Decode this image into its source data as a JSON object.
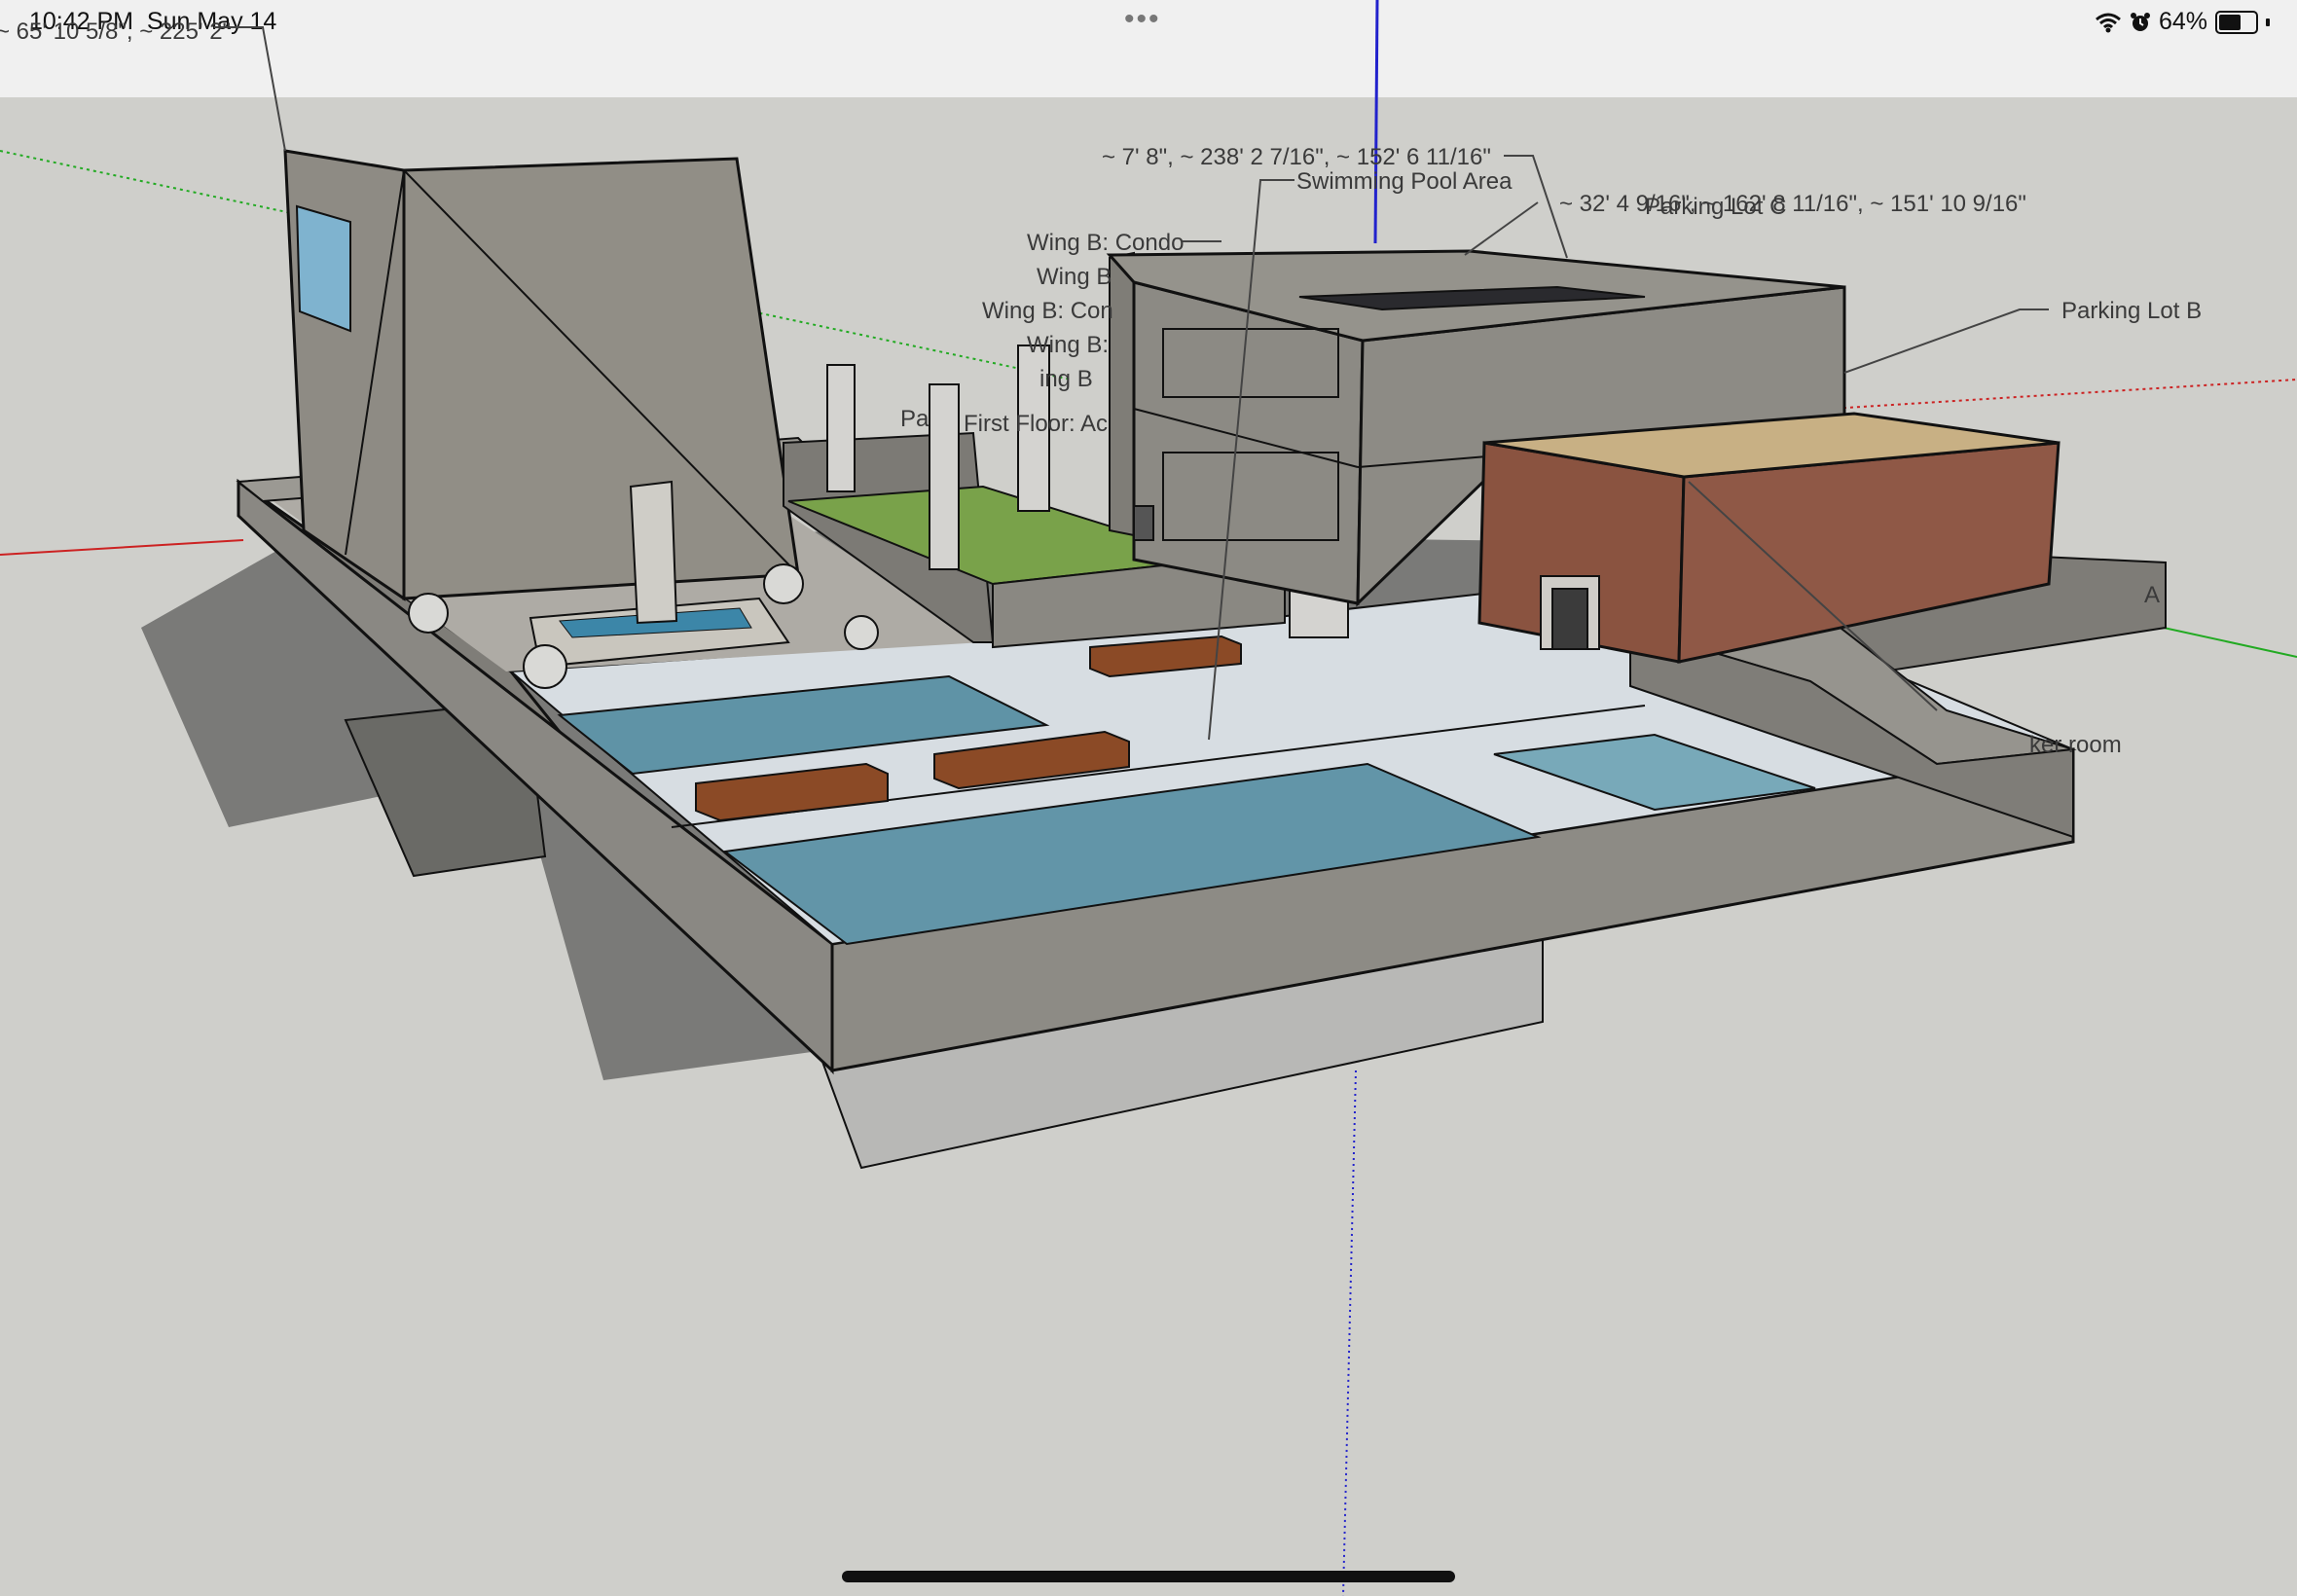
{
  "status_bar": {
    "time": "10:42 PM",
    "date": "Sun May 14",
    "battery": "64%",
    "battery_level": 0.64,
    "icons": [
      "wifi-icon",
      "alarm-icon",
      "battery-icon"
    ]
  },
  "colors": {
    "background": "#cfcfcb",
    "wall": "#8c8a84",
    "pool_water": "#5f93a6",
    "deck": "#d8dee3",
    "brick": "#8a5340",
    "roof": "#c8b084",
    "bench": "#8b4a26",
    "axis_red": "#cc2222",
    "axis_green": "#22aa22",
    "axis_blue": "#2222cc"
  },
  "annotations": {
    "top_left_coords": "~ 65' 10 5/8\", ~ 225' 2\"",
    "coords_1": "~ 7' 8\", ~ 238' 2 7/16\", ~ 152' 6 11/16\"",
    "swimming_pool_area": "Swimming Pool Area",
    "coords_2": "~ 32' 4 9/16\", ~ 162' 8 11/16\", ~ 151' 10 9/16\"",
    "parking_lot_c": "Parking Lot C",
    "parking_lot_b": "Parking Lot B",
    "wing_b_condo": "Wing B: Condo",
    "wing_b_2": "Wing B",
    "wing_b_3": "Wing B: Con",
    "wing_b_4": "Wing B:",
    "wing_b_5": "ing B",
    "first_floor": "First Floor: Ac",
    "pa": "Pa",
    "locker_room": "ker room",
    "a_label": "A"
  }
}
